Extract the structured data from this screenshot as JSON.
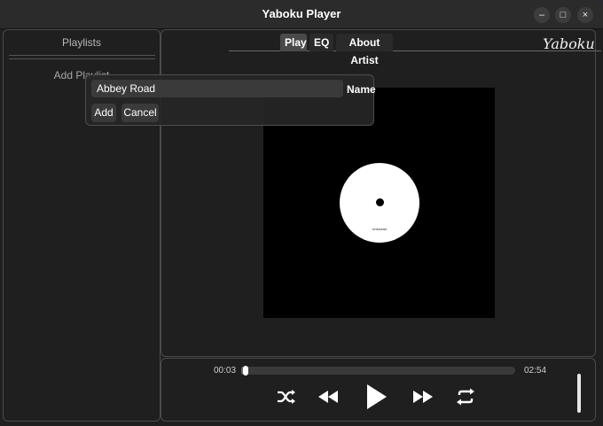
{
  "window": {
    "title": "Yaboku Player",
    "minimize_icon": "–",
    "maximize_icon": "□",
    "close_icon": "×"
  },
  "sidebar": {
    "heading": "Playlists",
    "add_playlist_label": "Add Playlist"
  },
  "tabs": [
    {
      "label": "Play",
      "active": true
    },
    {
      "label": "EQ",
      "active": false
    },
    {
      "label": "About Artist",
      "active": false
    }
  ],
  "brand": {
    "logo_text": "Yaboku"
  },
  "album": {
    "disc_label": "Unknown"
  },
  "dialog": {
    "name_value": "Abbey Road",
    "name_label": "Name",
    "add_label": "Add",
    "cancel_label": "Cancel"
  },
  "player": {
    "current_time": "00:03",
    "total_time": "02:54",
    "progress_fraction": 0.017,
    "volume_fraction": 1.0,
    "controls": [
      "shuffle-icon",
      "previous-icon",
      "play-icon",
      "next-icon",
      "repeat-icon"
    ]
  },
  "colors": {
    "window_bg": "#1f1f1f",
    "titlebar_bg": "#2b2b2b",
    "accent": "#ffffff"
  }
}
